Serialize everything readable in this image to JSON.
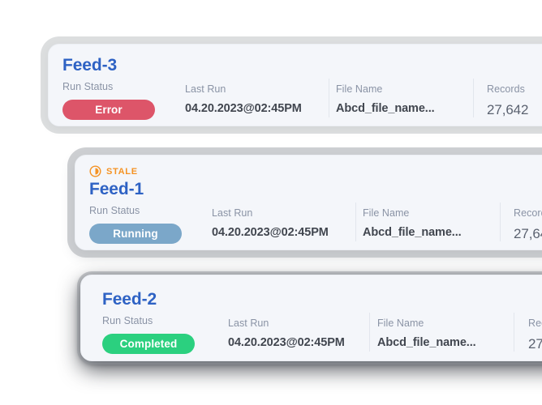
{
  "meta": {
    "background_color": "#ffffff",
    "card_background": "#f4f6fa",
    "title_color": "#2e62c4",
    "label_color": "#8a93a5",
    "value_color": "#41464f",
    "stale_color": "#f59324"
  },
  "columns": {
    "run_status": "Run Status",
    "last_run": "Last Run",
    "file_name": "File Name",
    "records": "Records"
  },
  "cards": [
    {
      "title": "Feed-3",
      "stale": null,
      "status": {
        "label": "Error",
        "color": "#dd5569",
        "variant": "error"
      },
      "last_run": "04.20.2023@02:45PM",
      "file_name": "Abcd_file_name...",
      "records": "27,642"
    },
    {
      "title": "Feed-1",
      "stale": {
        "label": "STALE",
        "icon": "stale-clock-icon",
        "color": "#f59324"
      },
      "status": {
        "label": "Running",
        "color": "#7ba7c9",
        "variant": "running"
      },
      "last_run": "04.20.2023@02:45PM",
      "file_name": "Abcd_file_name...",
      "records": "27,64"
    },
    {
      "title": "Feed-2",
      "stale": null,
      "status": {
        "label": "Completed",
        "color": "#2bd07f",
        "variant": "completed"
      },
      "last_run": "04.20.2023@02:45PM",
      "file_name": "Abcd_file_name...",
      "records": "27"
    }
  ],
  "truncated_headers": {
    "card2_records": "Recor",
    "card3_records": "Re"
  }
}
